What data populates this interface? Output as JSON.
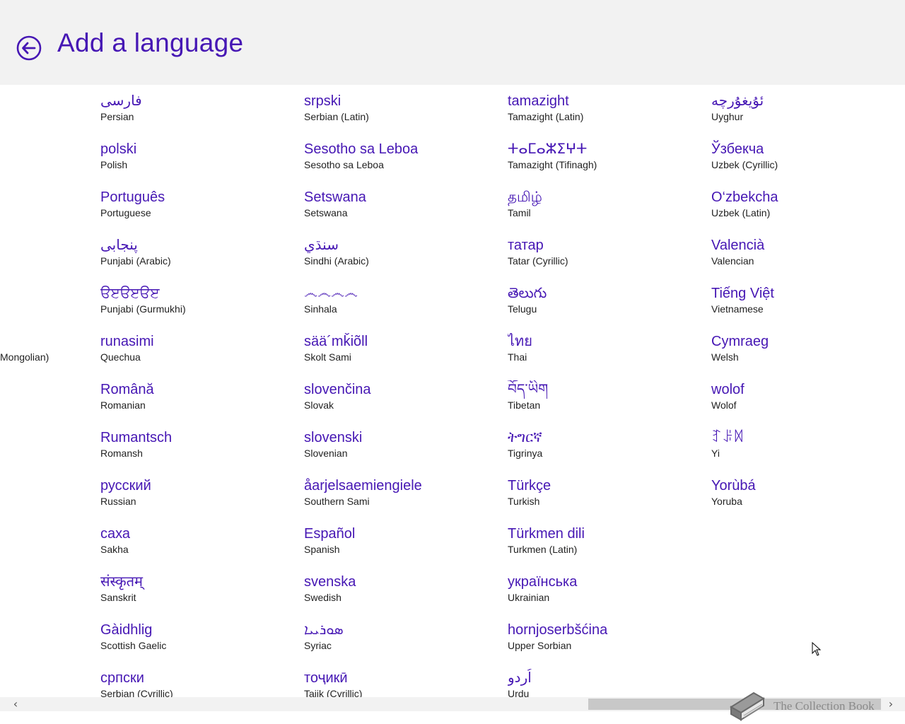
{
  "header": {
    "title": "Add a language",
    "back_icon": "back-arrow-icon"
  },
  "cut_item_label": "Mongolian)",
  "columns": [
    [
      {
        "native": "فارسی",
        "english": "Persian"
      },
      {
        "native": "polski",
        "english": "Polish"
      },
      {
        "native": "Português",
        "english": "Portuguese"
      },
      {
        "native": "پنجابی",
        "english": "Punjabi (Arabic)"
      },
      {
        "native": "ੳੲੳੲੳੲ",
        "english": "Punjabi (Gurmukhi)"
      },
      {
        "native": "runasimi",
        "english": "Quechua"
      },
      {
        "native": "Română",
        "english": "Romanian"
      },
      {
        "native": "Rumantsch",
        "english": "Romansh"
      },
      {
        "native": "русский",
        "english": "Russian"
      },
      {
        "native": "саха",
        "english": "Sakha"
      },
      {
        "native": "संस्कृतम्",
        "english": "Sanskrit"
      },
      {
        "native": "Gàidhlig",
        "english": "Scottish Gaelic"
      },
      {
        "native": "српски",
        "english": "Serbian (Cyrillic)"
      }
    ],
    [
      {
        "native": "srpski",
        "english": "Serbian (Latin)"
      },
      {
        "native": "Sesotho sa Leboa",
        "english": "Sesotho sa Leboa"
      },
      {
        "native": "Setswana",
        "english": "Setswana"
      },
      {
        "native": "سنڌي",
        "english": "Sindhi (Arabic)"
      },
      {
        "native": "෴෴෴෴",
        "english": "Sinhala"
      },
      {
        "native": "sää´mǩiõll",
        "english": "Skolt Sami"
      },
      {
        "native": "slovenčina",
        "english": "Slovak"
      },
      {
        "native": "slovenski",
        "english": "Slovenian"
      },
      {
        "native": "åarjelsaemiengiele",
        "english": "Southern Sami"
      },
      {
        "native": "Español",
        "english": "Spanish"
      },
      {
        "native": "svenska",
        "english": "Swedish"
      },
      {
        "native": "ܣܘܪܝܝܐ",
        "english": "Syriac"
      },
      {
        "native": "тоҷикӣ",
        "english": "Tajik (Cyrillic)"
      }
    ],
    [
      {
        "native": "tamazight",
        "english": "Tamazight (Latin)"
      },
      {
        "native": "ⵜⴰⵎⴰⵣⵉⵖⵜ",
        "english": "Tamazight (Tifinagh)"
      },
      {
        "native": "தமிழ்",
        "english": "Tamil"
      },
      {
        "native": "татар",
        "english": "Tatar (Cyrillic)"
      },
      {
        "native": "తెలుగు",
        "english": "Telugu"
      },
      {
        "native": "ไทย",
        "english": "Thai"
      },
      {
        "native": "བོད་ཡིག",
        "english": "Tibetan"
      },
      {
        "native": "ትግርኛ",
        "english": "Tigrinya"
      },
      {
        "native": "Türkçe",
        "english": "Turkish"
      },
      {
        "native": "Türkmen dili",
        "english": "Turkmen (Latin)"
      },
      {
        "native": "українська",
        "english": "Ukrainian"
      },
      {
        "native": "hornjoserbšćina",
        "english": "Upper Sorbian"
      },
      {
        "native": "اُردو",
        "english": "Urdu"
      }
    ],
    [
      {
        "native": "ئۇيغۇرچە",
        "english": "Uyghur"
      },
      {
        "native": "Ўзбекча",
        "english": "Uzbek (Cyrillic)"
      },
      {
        "native": "O‘zbekcha",
        "english": "Uzbek (Latin)"
      },
      {
        "native": "Valencià",
        "english": "Valencian"
      },
      {
        "native": "Tiếng Việt",
        "english": "Vietnamese"
      },
      {
        "native": "Cymraeg",
        "english": "Welsh"
      },
      {
        "native": "wolof",
        "english": "Wolof"
      },
      {
        "native": "ꆈꌠꉙ",
        "english": "Yi"
      },
      {
        "native": "Yorùbá",
        "english": "Yoruba"
      }
    ]
  ],
  "scrollbar": {
    "left_arrow": "‹",
    "right_arrow": "›"
  },
  "watermark": {
    "text": "The Collection Book",
    "icon": "book-icon"
  },
  "colors": {
    "accent": "#4617b4",
    "header_bg": "#f2f2f2",
    "text": "#222222"
  }
}
